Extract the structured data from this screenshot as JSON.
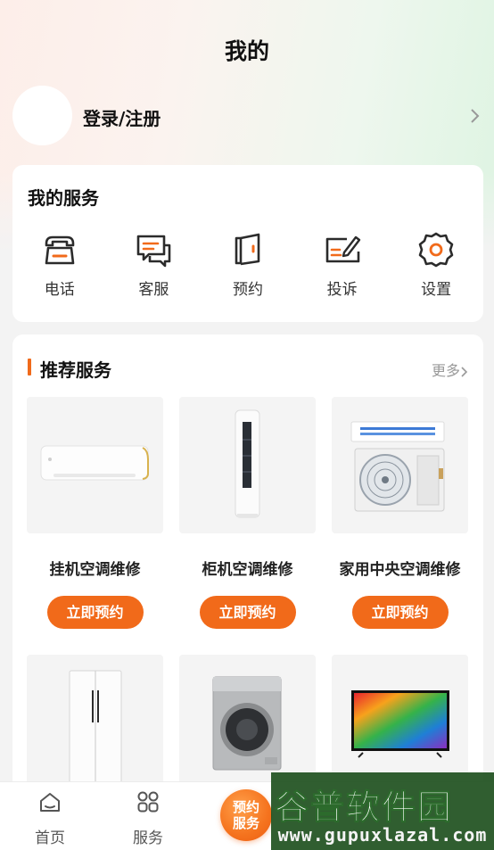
{
  "header": {
    "title": "我的"
  },
  "user": {
    "login_label": "登录/注册"
  },
  "services": {
    "title": "我的服务",
    "items": [
      {
        "label": "电话",
        "icon": "phone-icon"
      },
      {
        "label": "客服",
        "icon": "chat-icon"
      },
      {
        "label": "预约",
        "icon": "booking-icon"
      },
      {
        "label": "投诉",
        "icon": "complaint-icon"
      },
      {
        "label": "设置",
        "icon": "gear-icon"
      }
    ]
  },
  "recommend": {
    "title": "推荐服务",
    "more": "更多",
    "products": [
      {
        "name": "挂机空调维修",
        "button": "立即预约",
        "icon": "wall-ac-image"
      },
      {
        "name": "柜机空调维修",
        "button": "立即预约",
        "icon": "tower-ac-image"
      },
      {
        "name": "家用中央空调维修",
        "button": "立即预约",
        "icon": "central-ac-image"
      },
      {
        "name": "",
        "button": "",
        "icon": "fridge-image"
      },
      {
        "name": "",
        "button": "",
        "icon": "washer-image"
      },
      {
        "name": "",
        "button": "",
        "icon": "tv-image"
      }
    ]
  },
  "tabbar": {
    "items": [
      {
        "label": "首页",
        "icon": "home-icon"
      },
      {
        "label": "服务",
        "icon": "grid-icon"
      }
    ],
    "center": {
      "line1": "预约",
      "line2": "服务"
    }
  },
  "watermark": {
    "main": "谷普软件园",
    "sub": "www.gupuxlazal.com"
  },
  "colors": {
    "accent": "#f16a1a",
    "icon_dark": "#2b2b2b"
  }
}
